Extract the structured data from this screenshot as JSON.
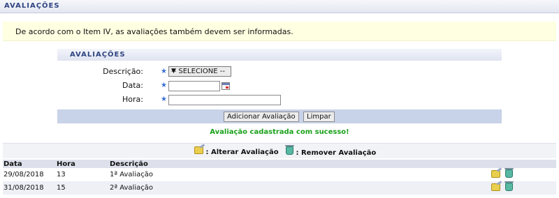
{
  "header": {
    "title": "AVALIAÇÕES"
  },
  "notice": {
    "text": "De acordo com o Item IV, as avaliações também devem ser informadas."
  },
  "form": {
    "caption": "AVALIAÇÕES",
    "descricao_label": "Descrição:",
    "descricao_value": "-- SELECIONE --",
    "data_label": "Data:",
    "data_value": "",
    "hora_label": "Hora:",
    "hora_value": "",
    "required_marker": "★",
    "add_button": "Adicionar Avaliação",
    "clear_button": "Limpar"
  },
  "success_message": "Avaliação cadastrada com sucesso!",
  "legend": {
    "edit_label": ": Alterar Avaliação",
    "remove_label": ": Remover Avaliação"
  },
  "table": {
    "headers": {
      "data": "Data",
      "hora": "Hora",
      "descricao": "Descrição"
    },
    "rows": [
      {
        "data": "29/08/2018",
        "hora": "13",
        "descricao": "1ª Avaliação"
      },
      {
        "data": "31/08/2018",
        "hora": "15",
        "descricao": "2ª Avaliação"
      }
    ]
  },
  "colors": {
    "accent": "#2f4580",
    "success": "#1aa11a",
    "notice_bg": "#ffffe1",
    "button_bar": "#c8d2e8"
  },
  "icons": {
    "edit": "edit-pencil-icon",
    "remove": "trash-icon",
    "calendar": "calendar-icon",
    "required": "star-icon"
  }
}
